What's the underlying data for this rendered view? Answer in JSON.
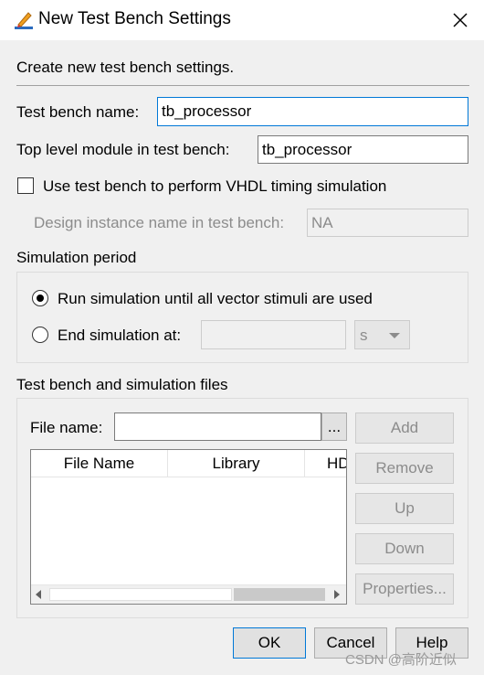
{
  "window": {
    "title": "New Test Bench Settings"
  },
  "intro": "Create new test bench settings.",
  "test_bench_name": {
    "label": "Test bench name:",
    "value": "tb_processor"
  },
  "top_level_module": {
    "label": "Top level module in test bench:",
    "value": "tb_processor"
  },
  "vhdl_timing": {
    "label": "Use test bench to perform VHDL timing simulation",
    "checked": false
  },
  "design_instance": {
    "label": "Design instance name in test bench:",
    "value": "NA"
  },
  "simulation_period": {
    "heading": "Simulation period",
    "run_until_label": "Run simulation until all vector stimuli are used",
    "end_at_label": "End simulation at:",
    "end_at_value": "",
    "unit": "s",
    "selected": "run_until"
  },
  "files": {
    "heading": "Test bench and simulation files",
    "file_name_label": "File name:",
    "file_name_value": "",
    "browse_label": "...",
    "columns": [
      "File Name",
      "Library",
      "HDL"
    ],
    "buttons": {
      "add": "Add",
      "remove": "Remove",
      "up": "Up",
      "down": "Down",
      "properties": "Properties..."
    }
  },
  "footer": {
    "ok": "OK",
    "cancel": "Cancel",
    "help": "Help"
  },
  "watermark": "CSDN @高阶近似"
}
